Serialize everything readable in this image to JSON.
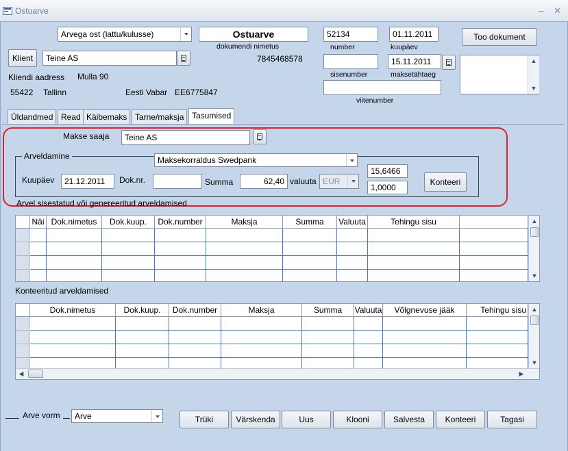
{
  "window": {
    "title": "Ostuarve",
    "minimize": "–",
    "close": "✕"
  },
  "header": {
    "doc_type": "Arvega ost (lattu/kulusse)",
    "doc_name": "Ostuarve",
    "doc_name_label": "dokumendi nimetus",
    "client_button": "Klient",
    "client_name": "Teine AS",
    "client_code": "7845468578",
    "address_label": "Kliendi aadress",
    "address_street": "Mulla 90",
    "address_zip": "55422",
    "address_city": "Tallinn",
    "bank_name": "Eesti Vabar",
    "bank_account": "EE6775847",
    "number": "52134",
    "number_label": "number",
    "date": "01.11.2011",
    "date_label": "kuupäev",
    "internal_number": "",
    "internal_number_label": "sisenumber",
    "due_date": "15.11.2011",
    "due_date_label": "maksetähtaeg",
    "reference_number": "",
    "reference_number_label": "viitenumber",
    "fetch_button": "Too dokument",
    "notes": ""
  },
  "tabs": [
    {
      "label": "Üldandmed"
    },
    {
      "label": "Read"
    },
    {
      "label": "Käibemaks"
    },
    {
      "label": "Tarne/maksja"
    },
    {
      "label": "Tasumised"
    }
  ],
  "payment": {
    "payee_label": "Makse saaja",
    "payee": "Teine AS",
    "group_title": "Arveldamine",
    "method": "Maksekorraldus Swedpank",
    "date_label": "Kuupäev",
    "date": "21.12.2011",
    "docnr_label": "Dok.nr.",
    "docnr": "",
    "sum_label": "Summa",
    "sum": "62,40",
    "currency_label": "valuuta",
    "currency": "EUR",
    "rate1": "15,6466",
    "rate2": "1,0000",
    "post_button": "Konteeri"
  },
  "grid1": {
    "title": "Arvel sisestatud või genereeritud arveldamised",
    "columns": [
      "Näi",
      "Dok.nimetus",
      "Dok.kuup.",
      "Dok.number",
      "Maksja",
      "Summa",
      "Valuuta",
      "Tehingu sisu",
      ""
    ]
  },
  "grid2": {
    "title": "Konteeritud arveldamised",
    "columns": [
      "Dok.nimetus",
      "Dok.kuup.",
      "Dok.number",
      "Maksja",
      "Summa",
      "Valuuta",
      "Võlgnevuse jääk",
      "Tehingu sisu"
    ]
  },
  "footer": {
    "form_label": "Arve vorm",
    "form_value": "Arve",
    "buttons": [
      "Trüki",
      "Värskenda",
      "Uus",
      "Klooni",
      "Salvesta",
      "Konteeri",
      "Tagasi"
    ]
  },
  "scroll": {
    "up": "▲",
    "down": "▼",
    "left": "◀",
    "right": "▶"
  }
}
